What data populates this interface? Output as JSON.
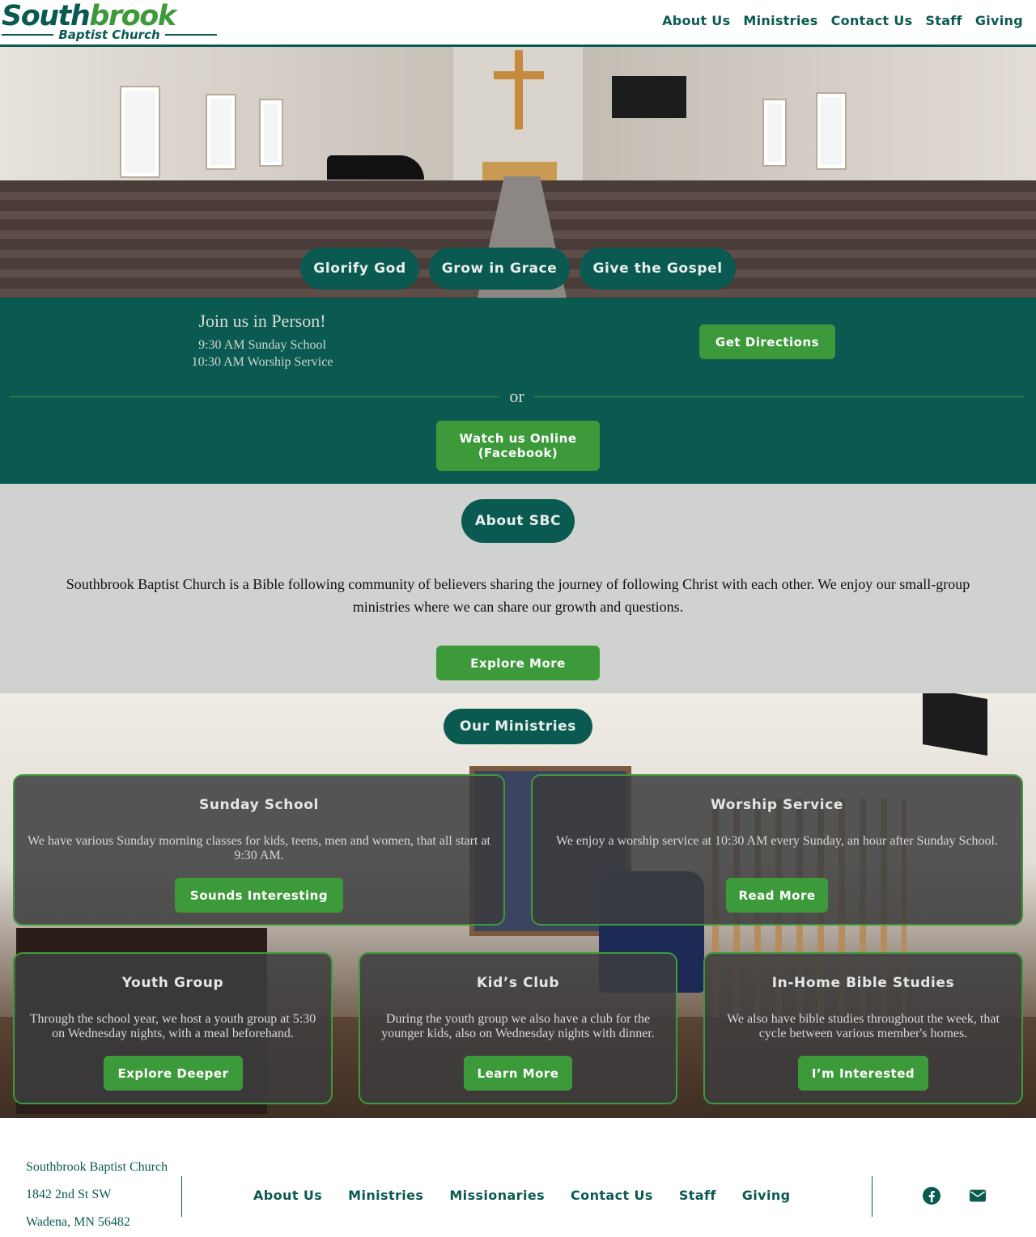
{
  "header": {
    "logo_main": "South",
    "logo_main_accent": "brook",
    "logo_sub": "Baptist Church",
    "nav": [
      "About Us",
      "Ministries",
      "Contact Us",
      "Staff",
      "Giving"
    ]
  },
  "hero": {
    "pills": [
      "Glorify God",
      "Grow in Grace",
      "Give the Gospel"
    ]
  },
  "service": {
    "title": "Join us in Person!",
    "times": [
      "9:30 AM Sunday School",
      "10:30 AM Worship Service"
    ],
    "directions_button": "Get Directions",
    "divider": "or",
    "watch_button_line1": "Watch us Online",
    "watch_button_line2": "(Facebook)"
  },
  "about": {
    "heading": "About SBC",
    "text": "Southbrook Baptist Church is a Bible following community of believers sharing the journey of following Christ with each other. We enjoy our small-group ministries where we can share our growth and questions.",
    "button": "Explore More"
  },
  "ministries": {
    "heading": "Our Ministries",
    "cards": [
      {
        "title": "Sunday School",
        "text": "We have various Sunday morning classes for kids, teens, men and women, that all start at 9:30 AM.",
        "button": "Sounds Interesting"
      },
      {
        "title": "Worship Service",
        "text": "We enjoy a worship service at 10:30 AM every Sunday, an hour after Sunday School.",
        "button": "Read More"
      },
      {
        "title": "Youth Group",
        "text": "Through the school year, we host a youth group at 5:30 on Wednesday nights, with a meal beforehand.",
        "button": "Explore Deeper"
      },
      {
        "title": "Kid’s Club",
        "text": "During the youth group we also have a club for the younger kids, also on Wednesday nights with dinner.",
        "button": "Learn More"
      },
      {
        "title": "In-Home Bible Studies",
        "text": "We also have bible studies throughout the week, that cycle between various member's homes.",
        "button": "I’m Interested"
      }
    ]
  },
  "footer": {
    "address": [
      "Southbrook Baptist Church",
      "1842 2nd St SW",
      "Wadena, MN 56482"
    ],
    "nav": [
      "About Us",
      "Ministries",
      "Missionaries",
      "Contact Us",
      "Staff",
      "Giving"
    ],
    "icons": [
      "facebook-icon",
      "email-icon"
    ]
  },
  "colors": {
    "primary": "#0b5a51",
    "accent": "#3d9a3a",
    "about_bg": "#d0d2cf"
  }
}
